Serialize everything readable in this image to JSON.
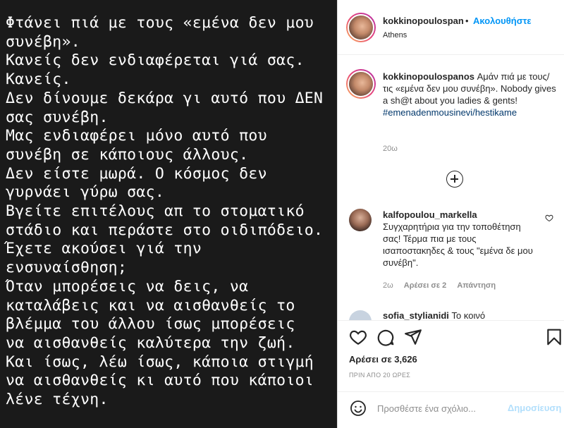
{
  "post": {
    "image_text_lines": [
      "Φτάνει πιά με τους «εμένα δεν μου",
      "συνέβη».",
      "Κανείς δεν ενδιαφέρεται γιά σας.",
      "Κανείς.",
      "Δεν δίνουμε δεκάρα γι αυτό που ΔΕΝ",
      "σας συνέβη.",
      "Μας ενδιαφέρει μόνο αυτό που",
      "συνέβη σε κάποιους άλλους.",
      "Δεν είστε μωρά. Ο κόσμος δεν",
      "γυρνάει γύρω σας.",
      "Βγείτε επιτέλους απ το στοματικό",
      "στάδιο και περάστε στο οιδιπόδειο.",
      "Έχετε ακούσει γιά την",
      "ενσυναίσθηση;",
      "Όταν μπορέσεις να δεις, να",
      "καταλάβεις και να αισθανθείς το",
      "βλέμμα του άλλου ίσως μπορέσεις",
      "να αισθανθείς καλύτερα την ζωή.",
      "Και ίσως, λέω ίσως, κάποια στιγμή",
      "να αισθανθείς κι αυτό που κάποιοι",
      "λένε τέχνη."
    ]
  },
  "header": {
    "username": "kokkinopoulospan",
    "separator": "•",
    "follow_label": "Ακολουθήστε",
    "location": "Athens"
  },
  "caption": {
    "username": "kokkinopoulospanos",
    "text": " Αμάν πιά με τους/τις «εμένα δεν μου συνέβη». Nobody gives a sh@t about you ladies & gents! ",
    "hashtag": "#emenadenmousinevi",
    "after_hashtag": "/hestikame",
    "time": "20ω"
  },
  "comments": [
    {
      "username": "kalfopoulou_markella",
      "text": "Συγχαρητήρια για την τοποθέτηση σας! Τέρμα πια με τους ισαποστακηδες & τους \"εμένα δε μου συνέβη\".",
      "time": "2ω",
      "likes": "Αρέσει σε 2",
      "reply": "Απάντηση"
    },
    {
      "username": "sofia_stylianidi",
      "text": " Το κοινό"
    }
  ],
  "actions": {
    "likes_text": "Αρέσει σε 3,626",
    "post_time": "ΠΡΙΝ ΑΠΟ 20 ΩΡΕΣ"
  },
  "comment_box": {
    "placeholder": "Προσθέστε ένα σχόλιο...",
    "post_label": "Δημοσίευση"
  },
  "colors": {
    "accent": "#0095f6",
    "hashtag": "#00376b",
    "muted": "#8e8e8e",
    "post_disabled": "#b2dffc",
    "image_bg": "#1a1a1a"
  },
  "icons": [
    "heart-icon",
    "comment-icon",
    "share-icon",
    "bookmark-icon",
    "plus-circle-icon",
    "emoji-icon",
    "small-heart-icon"
  ]
}
